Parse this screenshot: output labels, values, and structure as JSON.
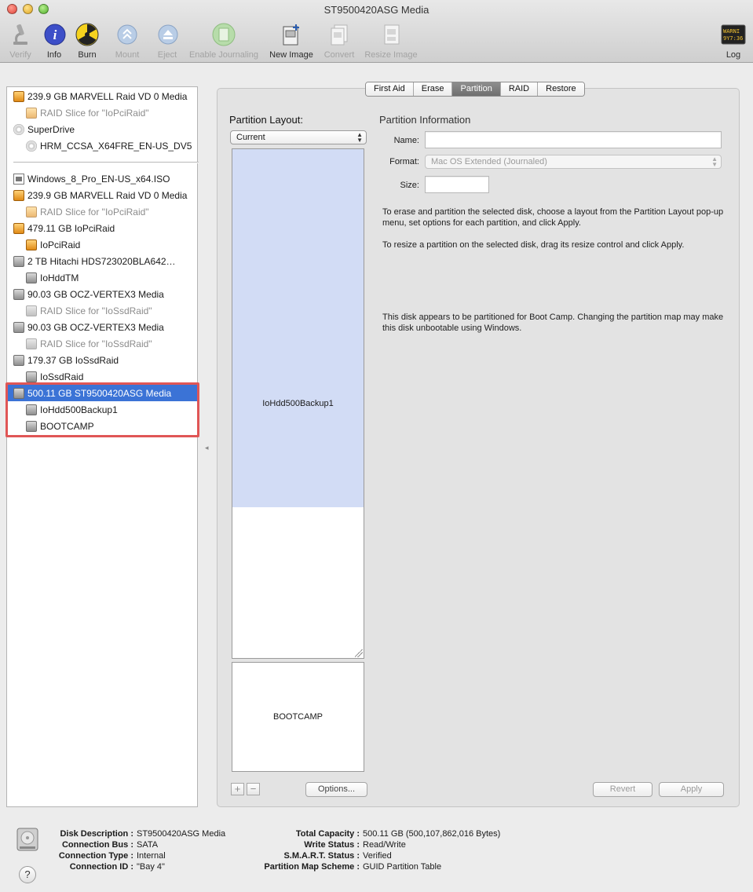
{
  "window": {
    "title": "ST9500420ASG Media"
  },
  "toolbar": {
    "verify": "Verify",
    "info": "Info",
    "burn": "Burn",
    "mount": "Mount",
    "eject": "Eject",
    "enable_journaling": "Enable Journaling",
    "new_image": "New Image",
    "convert": "Convert",
    "resize_image": "Resize Image",
    "log": "Log",
    "log_icon_text": "WARNI 9Y7:36"
  },
  "sidebar": {
    "items": [
      {
        "label": "239.9 GB MARVELL Raid VD 0 Media",
        "icon": "orange-raid-disk-icon"
      },
      {
        "label": "RAID Slice for \"IoPciRaid\"",
        "icon": "raid-slice-icon"
      },
      {
        "label": "SuperDrive",
        "icon": "optical-drive-icon"
      },
      {
        "label": "HRM_CCSA_X64FRE_EN-US_DV5",
        "icon": "disc-icon"
      },
      {
        "label": "Windows_8_Pro_EN-US_x64.ISO",
        "icon": "disk-image-file-icon"
      },
      {
        "label": "239.9 GB MARVELL Raid VD 0 Media",
        "icon": "orange-raid-disk-icon"
      },
      {
        "label": "RAID Slice for \"IoPciRaid\"",
        "icon": "raid-slice-icon"
      },
      {
        "label": "479.11 GB IoPciRaid",
        "icon": "orange-raid-disk-icon"
      },
      {
        "label": "IoPciRaid",
        "icon": "orange-volume-icon"
      },
      {
        "label": "2 TB Hitachi HDS723020BLA642…",
        "icon": "hard-disk-icon"
      },
      {
        "label": "IoHddTM",
        "icon": "volume-icon"
      },
      {
        "label": "90.03 GB OCZ-VERTEX3 Media",
        "icon": "hard-disk-icon"
      },
      {
        "label": "RAID Slice for \"IoSsdRaid\"",
        "icon": "raid-slice-icon"
      },
      {
        "label": "90.03 GB OCZ-VERTEX3 Media",
        "icon": "hard-disk-icon"
      },
      {
        "label": "RAID Slice for \"IoSsdRaid\"",
        "icon": "raid-slice-icon"
      },
      {
        "label": "179.37 GB IoSsdRaid",
        "icon": "hard-disk-icon"
      },
      {
        "label": "IoSsdRaid",
        "icon": "volume-icon"
      },
      {
        "label": "500.11 GB ST9500420ASG Media",
        "icon": "hard-disk-icon",
        "selected": true
      },
      {
        "label": "IoHdd500Backup1",
        "icon": "volume-icon"
      },
      {
        "label": "BOOTCAMP",
        "icon": "volume-icon"
      }
    ]
  },
  "tabs": [
    "First Aid",
    "Erase",
    "Partition",
    "RAID",
    "Restore"
  ],
  "active_tab": "Partition",
  "partition_layout": {
    "title": "Partition Layout:",
    "selected": "Current",
    "partitions": [
      {
        "name": "IoHdd500Backup1",
        "used_fraction": 0.7
      },
      {
        "name": "BOOTCAMP"
      }
    ],
    "add": "+",
    "remove": "−",
    "options": "Options..."
  },
  "partition_info": {
    "title": "Partition Information",
    "name_label": "Name:",
    "name_value": "",
    "format_label": "Format:",
    "format_value": "Mac OS Extended (Journaled)",
    "size_label": "Size:",
    "size_value": "",
    "help1": "To erase and partition the selected disk, choose a layout from the Partition Layout pop-up menu, set options for each partition, and click Apply.",
    "help2": "To resize a partition on the selected disk, drag its resize control and click Apply.",
    "help3": "This disk appears to be partitioned for Boot Camp. Changing the partition map may make this disk unbootable using Windows."
  },
  "buttons": {
    "revert": "Revert",
    "apply": "Apply"
  },
  "disk_info": {
    "left": [
      {
        "key": "Disk Description :",
        "value": "ST9500420ASG Media"
      },
      {
        "key": "Connection Bus :",
        "value": "SATA"
      },
      {
        "key": "Connection Type :",
        "value": "Internal"
      },
      {
        "key": "Connection ID :",
        "value": "\"Bay 4\""
      }
    ],
    "right": [
      {
        "key": "Total Capacity :",
        "value": "500.11 GB (500,107,862,016 Bytes)"
      },
      {
        "key": "Write Status :",
        "value": "Read/Write"
      },
      {
        "key": "S.M.A.R.T. Status :",
        "value": "Verified"
      },
      {
        "key": "Partition Map Scheme :",
        "value": "GUID Partition Table"
      }
    ]
  },
  "help_button": "?",
  "colors": {
    "selection": "#3b73d6",
    "partition_fill": "#d2dcf5",
    "highlight": "#e05656"
  }
}
